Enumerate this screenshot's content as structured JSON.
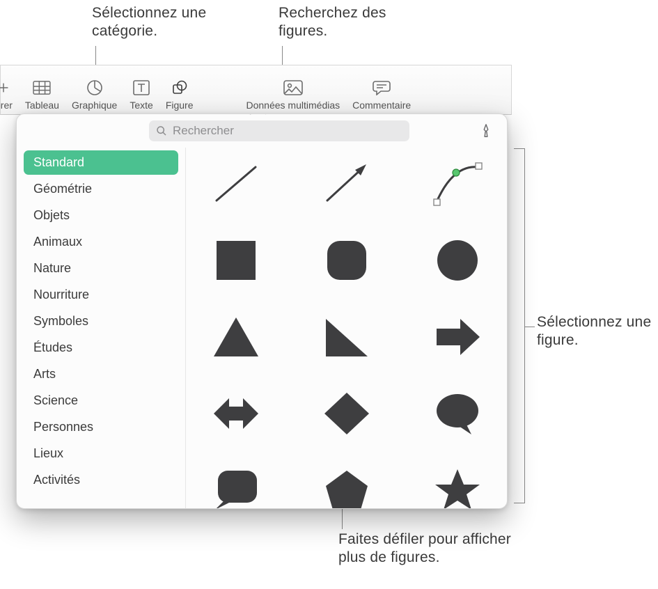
{
  "callouts": {
    "select_category": "Sélectionnez une catégorie.",
    "search_shapes": "Recherchez des figures.",
    "select_shape": "Sélectionnez une figure.",
    "scroll_more": "Faites défiler pour afficher plus de figures."
  },
  "toolbar": {
    "insert": "érer",
    "table": "Tableau",
    "chart": "Graphique",
    "text": "Texte",
    "shape": "Figure",
    "media": "Données multimédias",
    "comment": "Commentaire"
  },
  "popover": {
    "search_placeholder": "Rechercher",
    "categories": [
      "Standard",
      "Géométrie",
      "Objets",
      "Animaux",
      "Nature",
      "Nourriture",
      "Symboles",
      "Études",
      "Arts",
      "Science",
      "Personnes",
      "Lieux",
      "Activités"
    ],
    "active_category_index": 0,
    "shapes": [
      "line",
      "arrow-line",
      "curve-editable",
      "square",
      "rounded-square",
      "circle",
      "triangle",
      "right-triangle",
      "arrow-right",
      "double-arrow-horizontal",
      "diamond",
      "speech-bubble",
      "callout-rounded",
      "pentagon",
      "star"
    ]
  }
}
